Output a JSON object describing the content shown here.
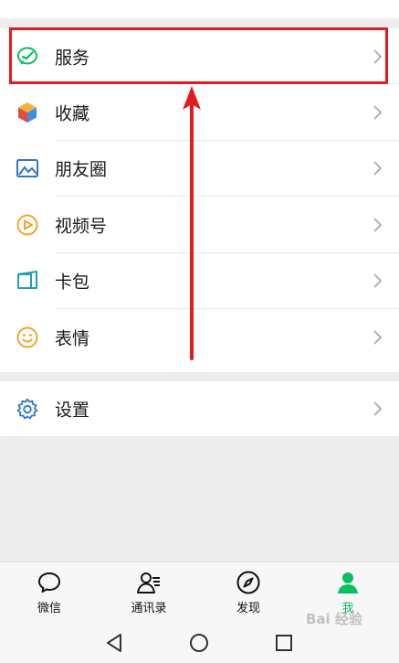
{
  "menu": {
    "items": [
      {
        "label": "服务",
        "icon": "service-icon"
      },
      {
        "label": "收藏",
        "icon": "favorites-cube-icon"
      },
      {
        "label": "朋友圈",
        "icon": "moments-image-icon"
      },
      {
        "label": "视频号",
        "icon": "channels-play-icon"
      },
      {
        "label": "卡包",
        "icon": "card-wallet-icon"
      },
      {
        "label": "表情",
        "icon": "sticker-smiley-icon"
      }
    ],
    "settings": {
      "label": "设置",
      "icon": "gear-icon"
    }
  },
  "annotation": {
    "color": "#e31b1b",
    "highlighted_item": "服务"
  },
  "tabbar": {
    "tabs": [
      {
        "label": "微信",
        "icon": "chat-bubble-icon",
        "active": false
      },
      {
        "label": "通讯录",
        "icon": "contacts-icon",
        "active": false
      },
      {
        "label": "发现",
        "icon": "compass-icon",
        "active": false
      },
      {
        "label": "我",
        "icon": "person-icon",
        "active": true
      }
    ]
  },
  "watermark": {
    "text": "Bai 经验"
  },
  "colors": {
    "accent": "#07c160",
    "annotation": "#e31b1b",
    "background": "#ededed"
  }
}
